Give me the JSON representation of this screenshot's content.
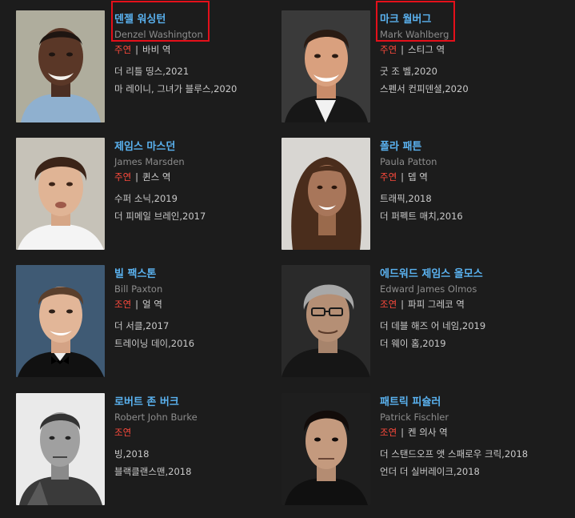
{
  "cast": [
    {
      "kor_name": "덴젤 워싱턴",
      "eng_name": "Denzel Washington",
      "role_type": "주연",
      "role": "바비 역",
      "works": [
        "더 리틀 띵스,2021",
        "마 레이니, 그녀가 블루스,2020"
      ]
    },
    {
      "kor_name": "마크 월버그",
      "eng_name": "Mark Wahlberg",
      "role_type": "주연",
      "role": "스티그 역",
      "works": [
        "굿 조 벨,2020",
        "스펜서 컨피덴셜,2020"
      ]
    },
    {
      "kor_name": "제임스 마스던",
      "eng_name": "James Marsden",
      "role_type": "주연",
      "role": "퀸스 역",
      "works": [
        "수퍼 소닉,2019",
        "더 피메일 브레인,2017"
      ]
    },
    {
      "kor_name": "폴라 패튼",
      "eng_name": "Paula Patton",
      "role_type": "주연",
      "role": "뎁 역",
      "works": [
        "트래픽,2018",
        "더 퍼펙트 매치,2016"
      ]
    },
    {
      "kor_name": "빌 팩스톤",
      "eng_name": "Bill Paxton",
      "role_type": "조연",
      "role": "얼 역",
      "works": [
        "더 서클,2017",
        "트레이닝 데이,2016"
      ]
    },
    {
      "kor_name": "에드워드 제임스 올모스",
      "eng_name": "Edward James Olmos",
      "role_type": "조연",
      "role": "파피 그레코 역",
      "works": [
        "더 데블 해즈 어 네임,2019",
        "더 웨이 홈,2019"
      ]
    },
    {
      "kor_name": "로버트 존 버크",
      "eng_name": "Robert John Burke",
      "role_type": "조연",
      "role": "",
      "works": [
        "빙,2018",
        "블랙클랜스맨,2018"
      ]
    },
    {
      "kor_name": "패트릭 피슐러",
      "eng_name": "Patrick Fischler",
      "role_type": "조연",
      "role": "켄 의사 역",
      "works": [
        "더 스탠드오프 앳 스패로우 크릭,2018",
        "언더 더 실버레이크,2018"
      ]
    }
  ],
  "colors": {
    "background": "#1c1c1c",
    "name_link": "#5ab2f0",
    "role_type": "#ff4a3c",
    "highlight": "#e4101a"
  }
}
